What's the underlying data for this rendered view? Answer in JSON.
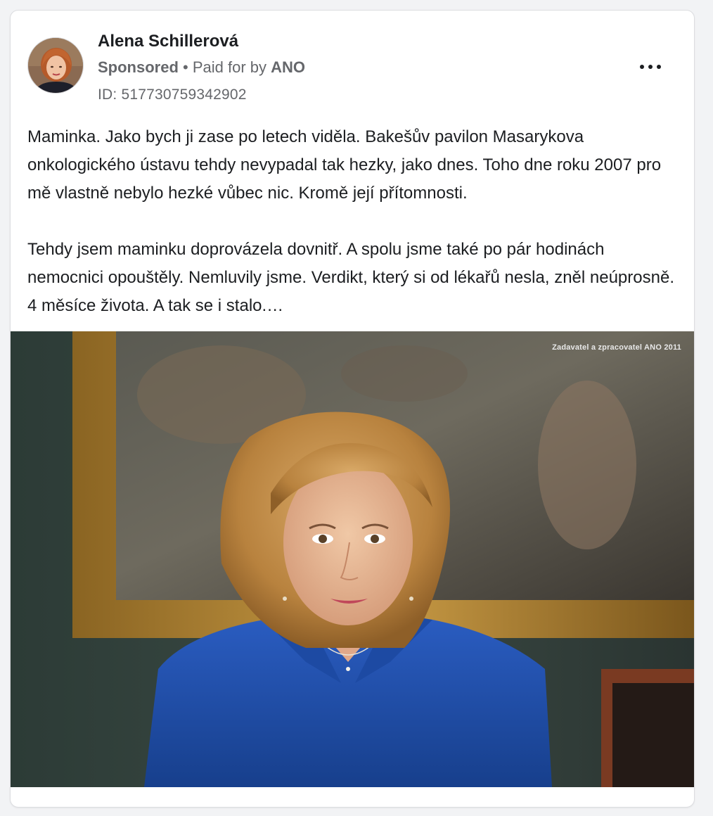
{
  "post": {
    "author": "Alena Schillerová",
    "sponsored_label": "Sponsored",
    "separator": " • ",
    "paid_for_label": "Paid for by ",
    "sponsor": "ANO",
    "ad_id": "ID: 517730759342902",
    "paragraphs": [
      "Maminka. Jako bych ji zase po letech viděla. Bakešův pavilon Masarykova onkologického ústavu tehdy nevypadal tak hezky, jako dnes. Toho dne roku 2007 pro mě vlastně nebylo hezké vůbec nic. Kromě její přítomnosti.",
      "Tehdy jsem maminku doprovázela dovnitř. A spolu jsme také po pár hodinách nemocnici opouštěly. Nemluvily jsme. Verdikt, který si od lékařů nesla, zněl neúprosně. 4 měsíce života. A tak se i stalo.…"
    ],
    "image_watermark": "Zadavatel a zpracovatel ANO 2011",
    "more_icon": "more-options-icon"
  },
  "colors": {
    "primary_text": "#1c1e21",
    "secondary_text": "#65676b",
    "card_bg": "#ffffff",
    "page_bg": "#f2f3f5",
    "shirt_blue": "#1f4fa8",
    "frame_gold": "#b8892f"
  }
}
